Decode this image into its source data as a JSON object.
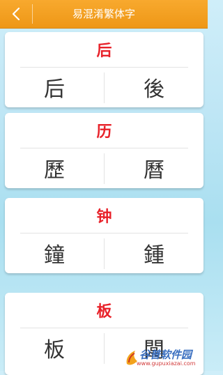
{
  "header": {
    "title": "易混淆繁体字",
    "back_icon": "chevron-left-icon"
  },
  "colors": {
    "header": "#f29e20",
    "accent_char": "#e8222a",
    "option_char": "#333333"
  },
  "cards": [
    {
      "simplified": "后",
      "options": [
        "后",
        "後"
      ]
    },
    {
      "simplified": "历",
      "options": [
        "歷",
        "曆"
      ]
    },
    {
      "simplified": "钟",
      "options": [
        "鐘",
        "鍾"
      ]
    },
    {
      "simplified": "板",
      "options": [
        "板",
        "闆"
      ]
    }
  ],
  "watermark": {
    "brand": "谷普软件园",
    "url": "www.gupuxiazai.com"
  }
}
